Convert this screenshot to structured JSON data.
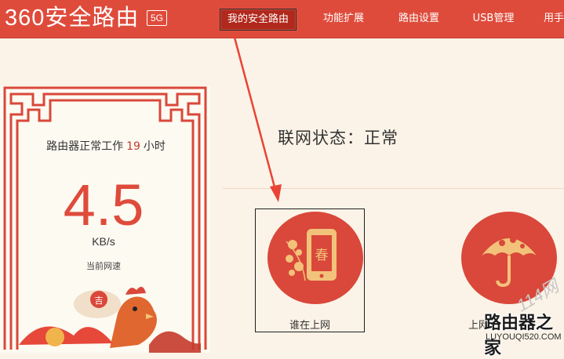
{
  "header": {
    "logo_text": "360安全路由",
    "badge": "5G",
    "nav": [
      {
        "label": "我的安全路由",
        "active": true
      },
      {
        "label": "功能扩展",
        "active": false
      },
      {
        "label": "路由设置",
        "active": false
      },
      {
        "label": "USB管理",
        "active": false
      },
      {
        "label": "用手",
        "active": false
      }
    ]
  },
  "panel": {
    "uptime_prefix": "路由器正常工作",
    "uptime_hours": "19",
    "uptime_suffix": "小时",
    "speed_value": "4.5",
    "speed_unit": "KB/s",
    "speed_label": "当前网速"
  },
  "main": {
    "status_text": "联网状态：正常",
    "cards": [
      {
        "label": "谁在上网",
        "icon": "phone-spring-icon"
      },
      {
        "label": "上网",
        "icon": "umbrella-icon"
      }
    ]
  },
  "watermark": {
    "top": "114网",
    "main": "路由器之家",
    "url": "LUYOUQI520.COM"
  },
  "colors": {
    "brand_red": "#df4b3b",
    "active_nav": "#b1281c",
    "background": "#fbf3e7",
    "icon_gold": "#f3c27a"
  }
}
